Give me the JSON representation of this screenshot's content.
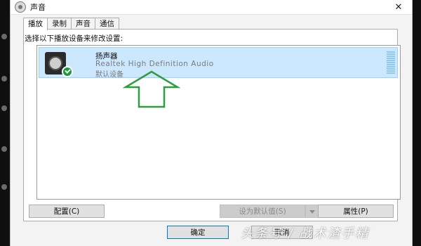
{
  "window": {
    "title": "声音",
    "close_glyph": "✕"
  },
  "tabs": [
    {
      "label": "播放",
      "active": true
    },
    {
      "label": "录制",
      "active": false
    },
    {
      "label": "声音",
      "active": false
    },
    {
      "label": "通信",
      "active": false
    }
  ],
  "instruction": "选择以下播放设备来修改设置:",
  "devices": [
    {
      "name": "扬声器",
      "driver": "Realtek High Definition Audio",
      "status": "默认设备",
      "icon": "speaker-icon",
      "badge_icon": "check-icon",
      "selected": true
    }
  ],
  "buttons": {
    "configure": "配置(C)",
    "set_default": "设为默认值(S)",
    "properties": "属性(P)",
    "ok": "确定",
    "cancel": "取消"
  },
  "watermark": "头条号 / 战术渣手精",
  "colors": {
    "selection_bg": "#cce8ff",
    "arrow": "#2e9e3e",
    "check_badge": "#1a9b3a",
    "focus_border": "#0078d7"
  }
}
